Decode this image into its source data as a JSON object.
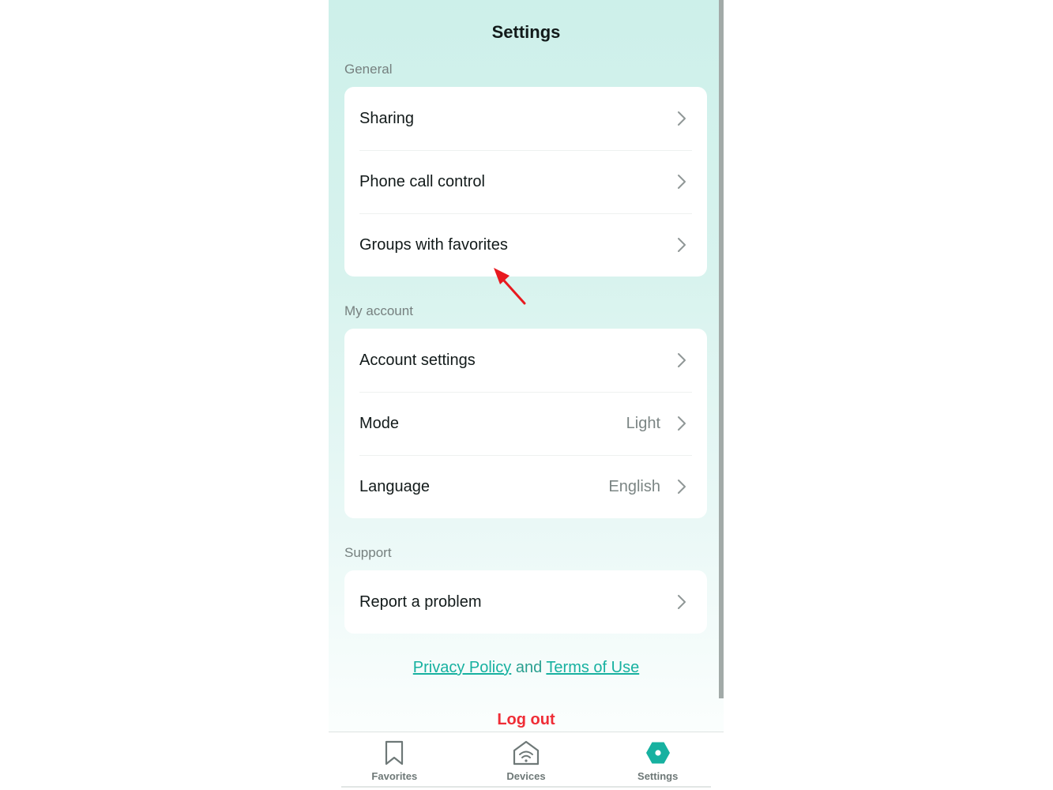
{
  "header": {
    "title": "Settings"
  },
  "sections": {
    "general": {
      "label": "General",
      "items": [
        {
          "label": "Sharing"
        },
        {
          "label": "Phone call control"
        },
        {
          "label": "Groups with favorites"
        }
      ]
    },
    "my_account": {
      "label": "My account",
      "items": [
        {
          "label": "Account settings"
        },
        {
          "label": "Mode",
          "value": "Light"
        },
        {
          "label": "Language",
          "value": "English"
        }
      ]
    },
    "support": {
      "label": "Support",
      "items": [
        {
          "label": "Report a problem"
        }
      ]
    }
  },
  "legal": {
    "privacy_label": "Privacy Policy",
    "conjunction": "and",
    "terms_label": "Terms of Use"
  },
  "logout_label": "Log out",
  "tabbar": {
    "tabs": [
      {
        "label": "Favorites",
        "icon": "bookmark-icon"
      },
      {
        "label": "Devices",
        "icon": "home-wifi-icon"
      },
      {
        "label": "Settings",
        "icon": "hexagon-gear-icon",
        "active": true
      }
    ]
  },
  "colors": {
    "accent": "#17b1a0",
    "logout": "#ef2d36",
    "annotation_arrow": "#e8191f"
  }
}
